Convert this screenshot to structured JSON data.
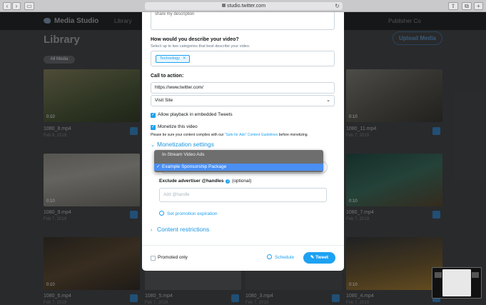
{
  "browser": {
    "url": "studio.twitter.com"
  },
  "app": {
    "brand": "Media Studio",
    "nav_library": "Library",
    "publisher": "Publisher Co",
    "page_title": "Library",
    "upload_label": "Upload Media",
    "filter_label": "All Media"
  },
  "tiles": [
    {
      "name": "1080_8.mp4",
      "date": "Feb 8, 2019",
      "duration": "0:10"
    },
    {
      "name": "1080_11.mp4",
      "date": "Feb 7, 2019",
      "duration": "0:10"
    },
    {
      "name": "1080_9.mp4",
      "date": "Feb 7, 2019",
      "duration": "0:10"
    },
    {
      "name": "1080_7.mp4",
      "date": "Feb 7, 2019",
      "duration": "0:10"
    },
    {
      "name": "1080_6.mp4",
      "date": "Feb 7, 2019",
      "duration": "0:10"
    },
    {
      "name": "1080_5.mp4",
      "date": "Feb 7, 2019",
      "duration": "0:10"
    },
    {
      "name": "1080_3.mp4",
      "date": "Feb 7, 2019",
      "duration": "0:10"
    },
    {
      "name": "1080_4.mp4",
      "date": "Feb 7, 2019",
      "duration": "0:10"
    }
  ],
  "modal": {
    "desc_partial": "share my description",
    "category_label": "How would you describe your video?",
    "category_help": "Select up to two categories that best describe your video.",
    "category_tag": "Technology",
    "cta_label": "Call to action:",
    "cta_url": "https://www.twitter.com/",
    "cta_select": "Visit Site",
    "allow_embed": "Allow playback in embedded Tweets",
    "monetize": "Monetize this video",
    "policy_prefix": "Please be sure your content complies with our ",
    "policy_link": "\"Safe for Ads\" Content Guidelines",
    "policy_suffix": " before monetizing.",
    "monetization_settings": "Monetization settings",
    "exclude_label": "Exclude advertiser @handles",
    "exclude_optional": "(optional)",
    "handles_placeholder": "Add @handle",
    "set_expiration": "Set promotion expiration",
    "content_restrictions": "Content restrictions",
    "promoted_only": "Promoted only",
    "schedule": "Schedule",
    "tweet": "Tweet"
  },
  "dropdown": {
    "options": [
      "In-Stream Video Ads",
      "Example Sponsorship Package"
    ],
    "selected_index": 1
  }
}
